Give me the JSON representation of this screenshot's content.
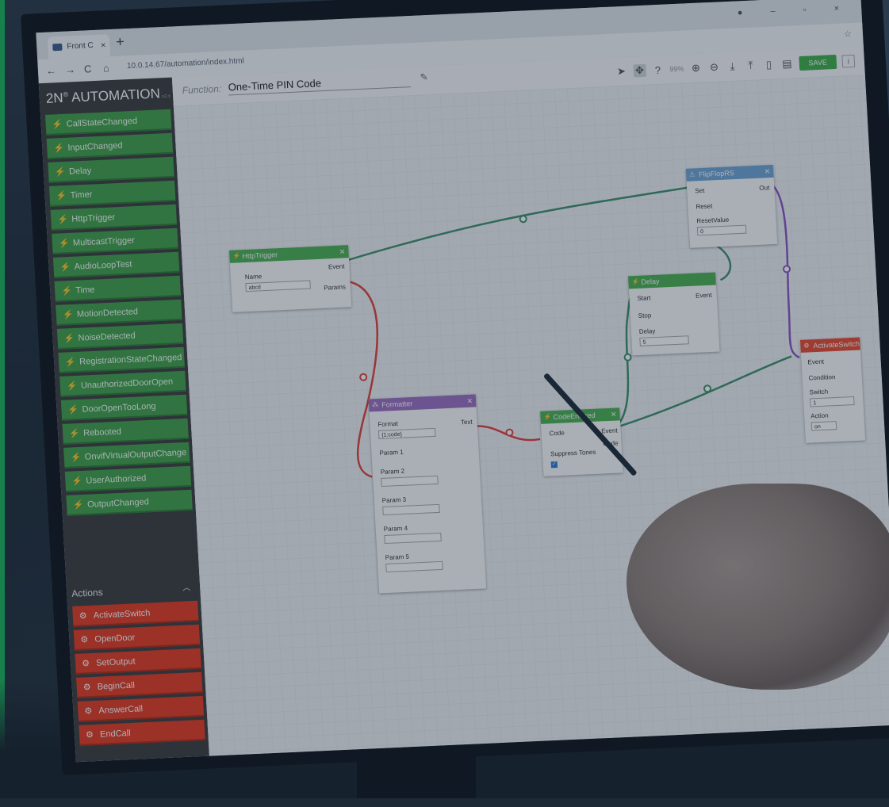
{
  "browser": {
    "tab_title": "Front C",
    "tab_close": "×",
    "new_tab": "+",
    "url": "10.0.14.67/automation/index.html",
    "nav_back": "←",
    "nav_forward": "→",
    "nav_reload": "C",
    "nav_home": "⌂"
  },
  "app": {
    "logo": "2N",
    "logo_mark": "®",
    "logo_word": " AUTOMATION",
    "logo_version": "v2.x",
    "function_label": "Function:",
    "function_name": "One-Time PIN Code",
    "save_label": "SAVE",
    "zoom_level": "99%"
  },
  "sidebar": {
    "events": [
      "CallStateChanged",
      "InputChanged",
      "Delay",
      "Timer",
      "HttpTrigger",
      "MulticastTrigger",
      "AudioLoopTest",
      "Time",
      "MotionDetected",
      "NoiseDetected",
      "RegistrationStateChanged",
      "UnauthorizedDoorOpen",
      "DoorOpenTooLong",
      "Rebooted",
      "OnvifVirtualOutputChange",
      "UserAuthorized",
      "OutputChanged"
    ],
    "actions_header": "Actions",
    "actions": [
      "ActivateSwitch",
      "OpenDoor",
      "SetOutput",
      "BeginCall",
      "AnswerCall",
      "EndCall"
    ]
  },
  "nodes": {
    "httptrigger": {
      "title": "HttpTrigger",
      "name_label": "Name",
      "name_value": "abcd",
      "event": "Event",
      "params": "Params"
    },
    "formatter": {
      "title": "Formatter",
      "format_label": "Format",
      "format_value": "{1:code}",
      "text": "Text",
      "param1": "Param 1",
      "param2": "Param 2",
      "param3": "Param 3",
      "param4": "Param 4",
      "param5": "Param 5"
    },
    "codeentered": {
      "title": "CodeEntered",
      "code_in": "Code",
      "event": "Event",
      "code_out": "Code",
      "suppress": "Suppress Tones"
    },
    "delay": {
      "title": "Delay",
      "start": "Start",
      "stop": "Stop",
      "event": "Event",
      "delay_label": "Delay",
      "delay_value": "5"
    },
    "flipflop": {
      "title": "FlipFlopRS",
      "set": "Set",
      "out": "Out",
      "reset": "Reset",
      "resetvalue_label": "ResetValue",
      "resetvalue_value": "0"
    },
    "activateswitch": {
      "title": "ActivateSwitch",
      "event": "Event",
      "condition": "Condition",
      "switch_label": "Switch",
      "switch_value": "1",
      "action_label": "Action",
      "action_value": "on"
    }
  },
  "colors": {
    "event_green": "#43a047",
    "action_red": "#e5391f",
    "wire_green": "#3e8f6a",
    "wire_red": "#e0403b",
    "wire_purple": "#8a55c2",
    "save_green": "#3fae49"
  }
}
